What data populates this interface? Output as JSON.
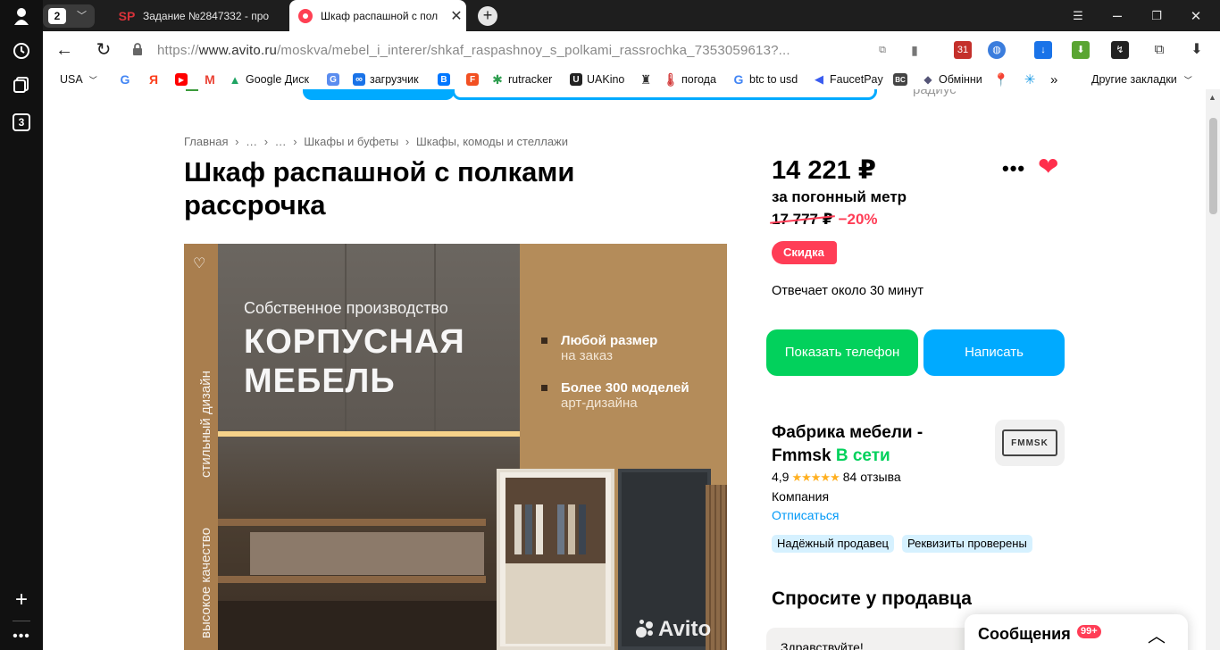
{
  "browser": {
    "tab_count": "2",
    "tabs": [
      {
        "favicon": "SP",
        "title": "Задание №2847332 - про"
      },
      {
        "favicon": "avito-icon",
        "title": "Шкаф распашной с пол"
      }
    ],
    "url_prefix": "https://",
    "url_host": "www.avito.ru",
    "url_path": "/moskva/mebel_i_interer/shkaf_raspashnoy_s_polkami_rassrochka_7353059613?...",
    "sidebar_count": "3"
  },
  "bookmarks": {
    "items": [
      {
        "label": "USA",
        "icon": "dropdown"
      },
      {
        "label": "",
        "icon": "google-icon",
        "color": "#4285f4",
        "glyph": "G"
      },
      {
        "label": "",
        "icon": "yandex-icon",
        "color": "#fc3f1d",
        "glyph": "Я"
      },
      {
        "label": "",
        "icon": "youtube-icon",
        "color": "#ff0000",
        "glyph": "▶"
      },
      {
        "label": "",
        "icon": "gmail-icon",
        "color": "#ea4335",
        "glyph": "M"
      },
      {
        "label": "Google Диск",
        "icon": "google-drive-icon",
        "color": "#1fa463",
        "glyph": "▲"
      },
      {
        "label": "",
        "icon": "translate-icon",
        "color": "#5b8def",
        "glyph": "G"
      },
      {
        "label": "загрузчик",
        "icon": "loader-icon",
        "color": "#1a73e8",
        "glyph": "∞"
      },
      {
        "label": "",
        "icon": "vk-icon",
        "color": "#0077ff",
        "glyph": "B"
      },
      {
        "label": "",
        "icon": "f-icon",
        "color": "#f25022",
        "glyph": "F"
      },
      {
        "label": "rutracker",
        "icon": "rutracker-icon",
        "color": "#2e9e4f",
        "glyph": "✱"
      },
      {
        "label": "UAKino",
        "icon": "uakino-icon",
        "color": "#222222",
        "glyph": "U"
      },
      {
        "label": "",
        "icon": "chess-icon",
        "color": "#333333",
        "glyph": "♜"
      },
      {
        "label": "погода",
        "icon": "thermometer-icon",
        "color": "#d33b3b",
        "glyph": "I"
      },
      {
        "label": "btc to usd",
        "icon": "google-icon",
        "color": "#4285f4",
        "glyph": "G"
      },
      {
        "label": "FaucetPay",
        "icon": "faucetpay-icon",
        "color": "#3a5cf0",
        "glyph": "◀"
      },
      {
        "label": "",
        "icon": "bc-icon",
        "color": "#444444",
        "glyph": "BC"
      },
      {
        "label": "Обмінни",
        "icon": "exchange-icon",
        "color": "#555577",
        "glyph": "◆"
      },
      {
        "label": "",
        "icon": "maps-icon",
        "color": "#34a853",
        "glyph": "⬤"
      },
      {
        "label": "",
        "icon": "star-icon",
        "color": "#1c9be6",
        "glyph": "✳"
      }
    ],
    "overflow": "»",
    "other": "Другие закладки"
  },
  "breadcrumbs": [
    "Главная",
    "›",
    "…",
    "›",
    "…",
    "›",
    "Шкафы и буфеты",
    "›",
    "Шкафы, комоды и стеллажи"
  ],
  "listing": {
    "title": "Шкаф распашной с полками рассрочка",
    "price": "14 221 ₽",
    "unit": "за погонный метр",
    "old_price": "17 777 ₽",
    "discount": "−20%",
    "sale_badge": "Скидка",
    "reply_time": "Отвечает около 30 минут",
    "show_phone": "Показать телефон",
    "write": "Написать"
  },
  "photo": {
    "subtitle": "Собственное производство",
    "headline_1": "КОРПУСНАЯ",
    "headline_2": "МЕБЕЛЬ",
    "bullet_1a": "Любой размер",
    "bullet_1b": "на заказ",
    "bullet_2a": "Более 300 моделей",
    "bullet_2b": "арт-дизайна",
    "vertical_1": "стильный дизайн",
    "vertical_2": "высокое качество",
    "watermark": "Avito"
  },
  "seller": {
    "name": "Фабрика мебели - Fmmsk",
    "status": "В сети",
    "rating": "4,9",
    "stars": "★★★★★",
    "reviews": "84 отзыва",
    "type": "Компания",
    "unsubscribe": "Отписаться",
    "logo_text": "FMMSK",
    "badges": [
      "Надёжный продавец",
      "Реквизиты проверены"
    ]
  },
  "ask": {
    "title": "Спросите у продавца",
    "message": "Здравствуйте!"
  },
  "messages": {
    "label": "Сообщения",
    "count": "99+"
  },
  "colors": {
    "green": "#02d15c",
    "blue": "#00aaff",
    "red": "#ff3d56"
  }
}
